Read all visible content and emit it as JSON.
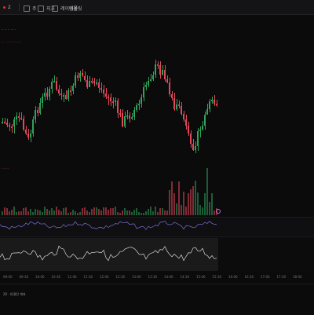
{
  "toolbar": {
    "symbol": "2",
    "interval_label": "주",
    "indicator_label": "지표",
    "layout_label": "레이아웃",
    "template_label": "템플릿"
  },
  "legend": {
    "line1": "·· ·· ·· ·· ··",
    "line2": "·· · ·· ·· ··· ·· ··"
  },
  "sub_legend": "· ·· ··",
  "bottom_bar": {
    "label": "20 · 연결된 계좌"
  },
  "time_axis": {
    "ticks": [
      "09:00",
      "09:30",
      "10:00",
      "10:30",
      "11:00",
      "11:30",
      "12:00",
      "12:30",
      "13:00",
      "13:30",
      "14:00",
      "14:30",
      "15:00",
      "15:30",
      "16:00",
      "16:30",
      "17:00",
      "17:30",
      "18:00"
    ]
  },
  "colors": {
    "up": "#2ea35a",
    "down": "#e0485a",
    "background": "#0b0b0c",
    "rsi": "#7b6fd1",
    "oscillator": "#d8d8d8"
  },
  "icons": {
    "toolbar": [
      "chart-type-icon",
      "indicator-icon",
      "settings-icon"
    ]
  }
}
